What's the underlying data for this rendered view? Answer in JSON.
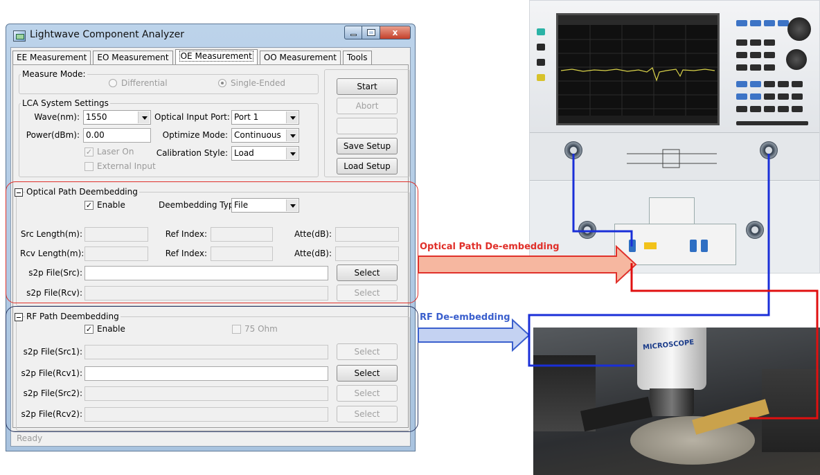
{
  "window": {
    "title": "Lightwave Component Analyzer",
    "controls": {
      "minimize": "",
      "maximize": "",
      "close": "x"
    }
  },
  "tabs": [
    {
      "label": "EE Measurement"
    },
    {
      "label": "EO Measurement"
    },
    {
      "label": "OE Measurement"
    },
    {
      "label": "OO Measurement"
    },
    {
      "label": "Tools"
    }
  ],
  "measure_mode": {
    "legend": "Measure Mode:",
    "differential_label": "Differential",
    "single_ended_label": "Single-Ended"
  },
  "lca_settings": {
    "legend": "LCA System Settings",
    "wave_label": "Wave(nm):",
    "wave_value": "1550",
    "power_label": "Power(dBm):",
    "power_value": "0.00",
    "laser_on_label": "Laser On",
    "external_input_label": "External Input",
    "optical_input_port_label": "Optical Input Port:",
    "optical_input_port_value": "Port 1",
    "optimize_mode_label": "Optimize Mode:",
    "optimize_mode_value": "Continuous",
    "calibration_style_label": "Calibration Style:",
    "calibration_style_value": "Load"
  },
  "side_buttons": {
    "start": "Start",
    "abort": "Abort",
    "blank": "",
    "save_setup": "Save Setup",
    "load_setup": "Load Setup"
  },
  "optical_path": {
    "legend": "Optical Path Deembedding",
    "enable_label": "Enable",
    "enable_checked": true,
    "deembedding_type_label": "Deembedding Type",
    "deembedding_type_value": "File",
    "src_length_label": "Src Length(m):",
    "rcv_length_label": "Rcv Length(m):",
    "ref_index_label": "Ref Index:",
    "atte_label": "Atte(dB):",
    "s2p_src_label": "s2p File(Src):",
    "s2p_rcv_label": "s2p File(Rcv):",
    "select_label": "Select"
  },
  "rf_path": {
    "legend": "RF Path Deembedding",
    "enable_label": "Enable",
    "enable_checked": true,
    "ohm75_label": "75 Ohm",
    "s2p_src1_label": "s2p File(Src1):",
    "s2p_rcv1_label": "s2p File(Rcv1):",
    "s2p_src2_label": "s2p File(Src2):",
    "s2p_rcv2_label": "s2p File(Rcv2):",
    "select_label": "Select"
  },
  "status": {
    "text": "Ready"
  },
  "annotations": {
    "optical_arrow_label": "Optical Path De-embedding",
    "rf_arrow_label": "RF De-embedding",
    "optical_color": "#e0302a",
    "rf_color": "#3a5fcd",
    "wire_blue": "#1a2fd8",
    "wire_red": "#e01010"
  },
  "probe_station": {
    "microscope_label": "MICROSCOPE"
  }
}
